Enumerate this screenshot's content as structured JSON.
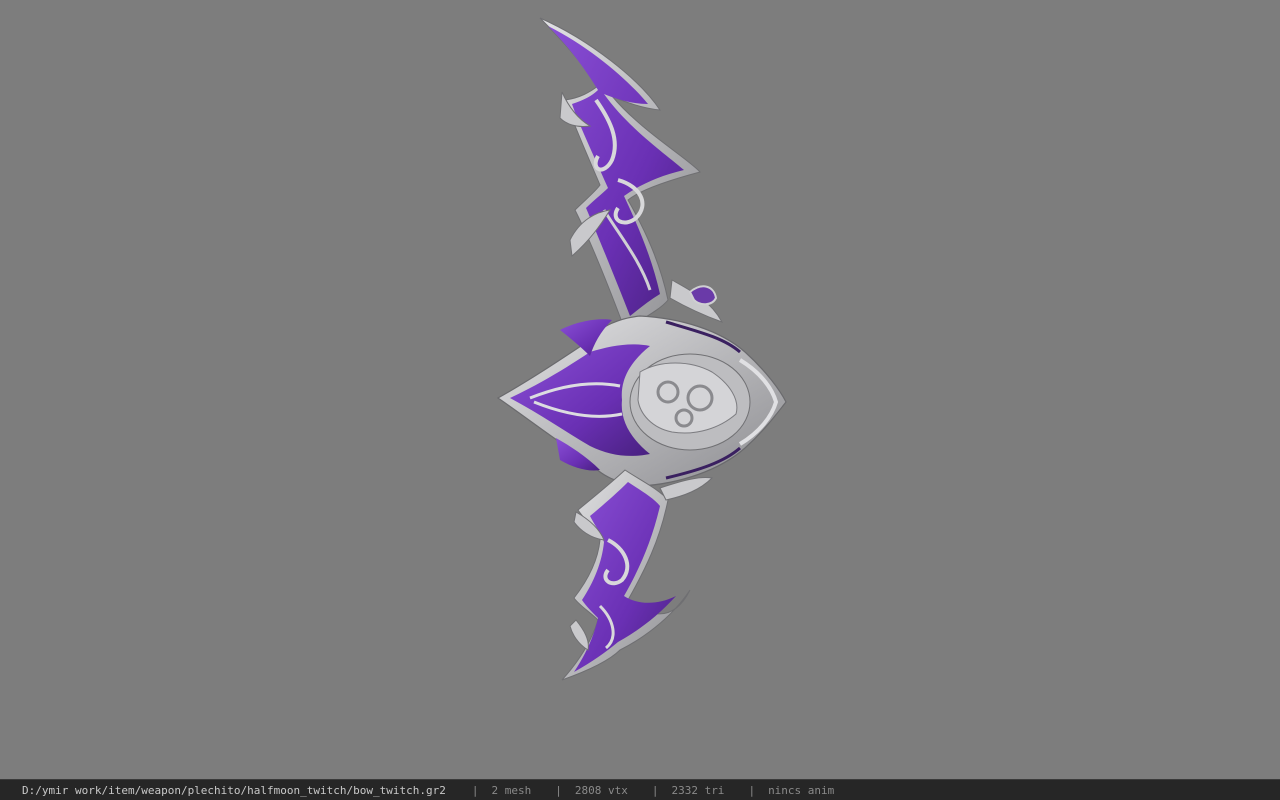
{
  "viewer": {
    "background_color": "#7d7d7d",
    "model_colors": {
      "metal": "#c6c6c8",
      "metal_dark": "#8f8f92",
      "crystal": "#7a3cc0",
      "crystal_dark": "#4b1f86"
    }
  },
  "status_bar": {
    "file_path": "D:/ymir work/item/weapon/plechito/halfmoon_twitch/bow_twitch.gr2",
    "separator": "|",
    "mesh_count": "2 mesh",
    "vertex_count": "2808 vtx",
    "triangle_count": "2332 tri",
    "animation": "nincs anim"
  }
}
